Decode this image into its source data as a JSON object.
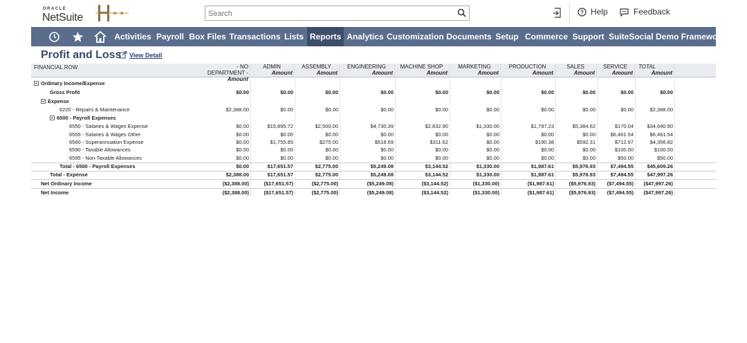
{
  "header": {
    "logo_oracle": "ORACLE",
    "logo_netsuite": "NetSuite",
    "search_placeholder": "Search",
    "help_label": "Help",
    "feedback_label": "Feedback"
  },
  "nav": {
    "items": [
      "Activities",
      "Payroll",
      "Box Files",
      "Transactions",
      "Lists",
      "Reports",
      "Analytics",
      "Customization",
      "Documents",
      "Setup",
      "Commerce",
      "Support",
      "SuiteSocial",
      "Demo Framework"
    ],
    "active": "Reports",
    "color": "#5a6d8c",
    "active_color": "#3d4e6b"
  },
  "page": {
    "title": "Profit and Loss",
    "view_detail": "View Detail"
  },
  "report": {
    "financial_row_header": "FINANCIAL ROW",
    "sub_header": "Amount",
    "columns": [
      "- NO DEPARTMENT -",
      "ADMIN",
      "ASSEMBLY",
      "ENGINEERING",
      "MACHINE SHOP",
      "MARKETING",
      "PRODUCTION",
      "SALES",
      "SERVICE",
      "TOTAL"
    ],
    "rows": [
      {
        "label": "Ordinary Income/Expense",
        "bold": true,
        "collapse": true,
        "indent": 0,
        "values": []
      },
      {
        "label": "Gross Profit",
        "bold": true,
        "indent": 2,
        "values": [
          "$0.00",
          "$0.00",
          "$0.00",
          "$0.00",
          "$0.00",
          "$0.00",
          "$0.00",
          "$0.00",
          "$0.00",
          "$0.00"
        ]
      },
      {
        "label": "Expense",
        "bold": true,
        "collapse": true,
        "indent": 1,
        "values": []
      },
      {
        "label": "6220 - Repairs & Maintenance",
        "indent": 3,
        "values": [
          "$2,388.00",
          "$0.00",
          "$0.00",
          "$0.00",
          "$0.00",
          "$0.00",
          "$0.00",
          "$0.00",
          "$0.00",
          "$2,388.00"
        ]
      },
      {
        "label": "6500 - Payroll Expenses",
        "bold": true,
        "collapse": true,
        "indent": 2,
        "values": []
      },
      {
        "label": "6550 - Salaries & Wages Expense",
        "indent": 4,
        "values": [
          "$0.00",
          "$15,895.72",
          "$2,500.00",
          "$4,730.39",
          "$2,832.90",
          "$1,330.00",
          "$1,797.23",
          "$5,384.62",
          "$170.04",
          "$34,640.90"
        ]
      },
      {
        "label": "6555 - Salaries & Wages Other",
        "indent": 4,
        "values": [
          "$0.00",
          "$0.00",
          "$0.00",
          "$0.00",
          "$0.00",
          "$0.00",
          "$0.00",
          "$0.00",
          "$6,461.54",
          "$6,461.54"
        ]
      },
      {
        "label": "6560 - Superannuation Expense",
        "indent": 4,
        "values": [
          "$0.00",
          "$1,755.85",
          "$275.00",
          "$518.69",
          "$311.62",
          "$0.00",
          "$190.38",
          "$592.31",
          "$712.97",
          "$4,356.82"
        ]
      },
      {
        "label": "6590 - Taxable Allowances",
        "indent": 4,
        "values": [
          "$0.00",
          "$0.00",
          "$0.00",
          "$0.00",
          "$0.00",
          "$0.00",
          "$0.00",
          "$0.00",
          "$100.00",
          "$100.00"
        ]
      },
      {
        "label": "6595 - Non-Taxable Allowances",
        "indent": 4,
        "values": [
          "$0.00",
          "$0.00",
          "$0.00",
          "$0.00",
          "$0.00",
          "$0.00",
          "$0.00",
          "$0.00",
          "$50.00",
          "$50.00"
        ]
      },
      {
        "label": "Total - 6500 - Payroll Expenses",
        "bold": true,
        "indent": 3,
        "values": [
          "$0.00",
          "$17,651.57",
          "$2,775.00",
          "$5,249.08",
          "$3,144.52",
          "$1,330.00",
          "$1,987.61",
          "$5,976.93",
          "$7,494.55",
          "$45,609.26"
        ]
      },
      {
        "label": "Total - Expense",
        "bold": true,
        "indent": 2,
        "values": [
          "$2,388.00",
          "$17,651.57",
          "$2,775.00",
          "$5,249.08",
          "$3,144.52",
          "$1,330.00",
          "$1,987.61",
          "$5,976.93",
          "$7,494.55",
          "$47,997.26"
        ]
      },
      {
        "label": "Net Ordinary Income",
        "bold": true,
        "indent": 1,
        "values": [
          "($2,388.00)",
          "($17,651.57)",
          "($2,775.00)",
          "($5,249.08)",
          "($3,144.52)",
          "($1,330.00)",
          "($1,987.61)",
          "($5,976.93)",
          "($7,494.55)",
          "($47,997.26)"
        ]
      },
      {
        "label": "Net Income",
        "bold": true,
        "indent": 1,
        "values": [
          "($2,388.00)",
          "($17,651.57)",
          "($2,775.00)",
          "($5,249.08)",
          "($3,144.52)",
          "($1,330.00)",
          "($1,987.61)",
          "($5,976.93)",
          "($7,494.55)",
          "($47,997.26)"
        ]
      }
    ]
  }
}
